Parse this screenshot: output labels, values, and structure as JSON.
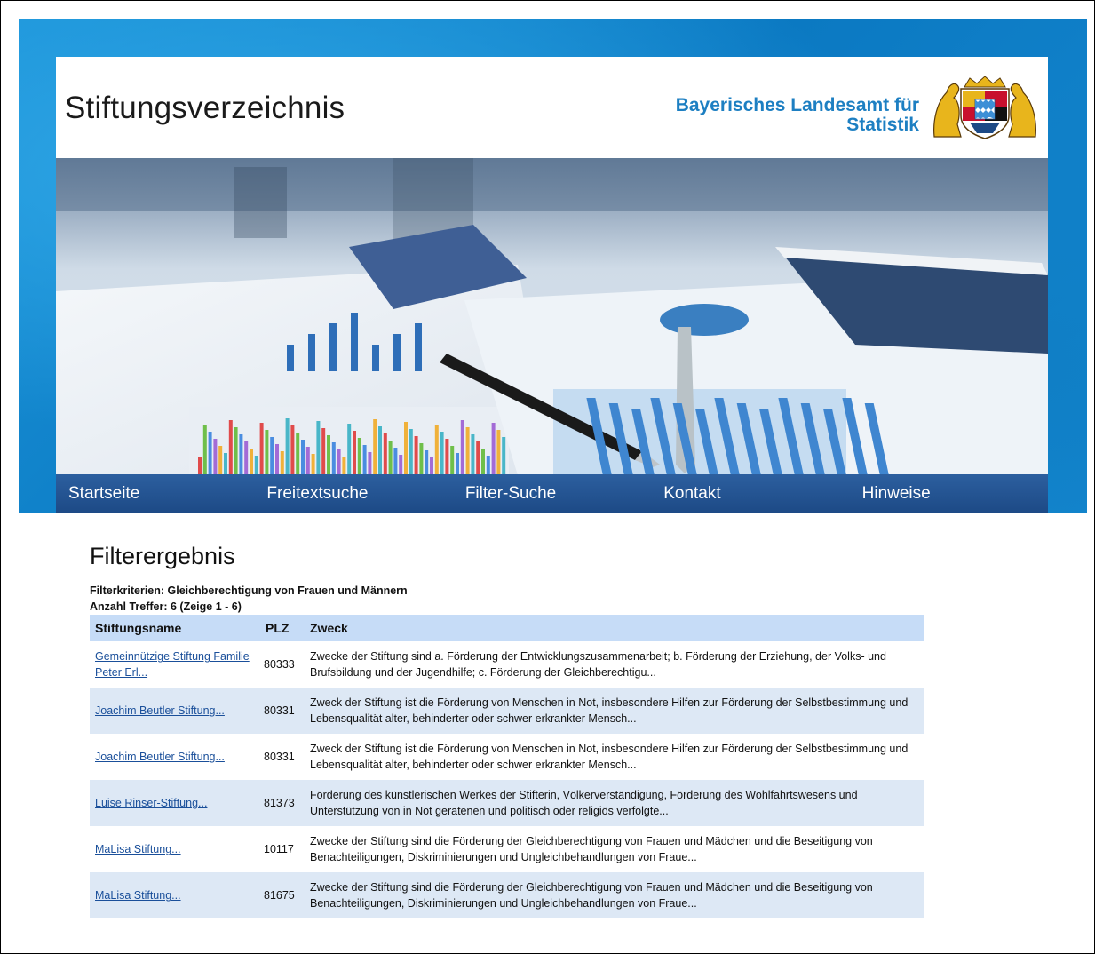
{
  "site": {
    "title": "Stiftungsverzeichnis",
    "agency_line1": "Bayerisches Landesamt für",
    "agency_line2": "Statistik",
    "coat_of_arms": "bavarian-coat-of-arms"
  },
  "nav": [
    {
      "label": "Startseite"
    },
    {
      "label": "Freitextsuche"
    },
    {
      "label": "Filter-Suche"
    },
    {
      "label": "Kontakt"
    },
    {
      "label": "Hinweise"
    }
  ],
  "result": {
    "heading": "Filterergebnis",
    "criteria": "Filterkriterien: Gleichberechtigung von Frauen und Männern",
    "count": "Anzahl Treffer: 6 (Zeige 1 - 6)",
    "columns": [
      "Stiftungsname",
      "PLZ",
      "Zweck"
    ],
    "rows": [
      {
        "name": "Gemeinnützige Stiftung Familie Peter Erl...",
        "plz": "80333",
        "zweck": "Zwecke der Stiftung sind a. Förderung der Entwicklungszusammenarbeit; b. Förderung der Erziehung, der Volks- und Brufsbildung und der Jugendhilfe; c. Förderung der Gleichberechtigu..."
      },
      {
        "name": "Joachim Beutler Stiftung...",
        "plz": "80331",
        "zweck": "Zweck der Stiftung ist die Förderung von Menschen in Not, insbesondere Hilfen zur Förderung der Selbstbestimmung und Lebensqualität alter, behinderter oder schwer erkrankter Mensch..."
      },
      {
        "name": "Joachim Beutler Stiftung...",
        "plz": "80331",
        "zweck": "Zweck der Stiftung ist die Förderung von Menschen in Not, insbesondere Hilfen zur Förderung der Selbstbestimmung und Lebensqualität alter, behinderter oder schwer erkrankter Mensch..."
      },
      {
        "name": "Luise Rinser-Stiftung...",
        "plz": "81373",
        "zweck": "Förderung des künstlerischen Werkes der Stifterin, Völkerverständigung, Förderung des Wohlfahrtswesens und Unterstützung von in Not geratenen und politisch oder religiös verfolgte..."
      },
      {
        "name": "MaLisa Stiftung...",
        "plz": "10117",
        "zweck": "Zwecke der Stiftung sind die Förderung der Gleichberechtigung von Frauen und Mädchen und die Beseitigung von Benachteiligungen, Diskriminierungen und Ungleichbehandlungen von Fraue..."
      },
      {
        "name": "MaLisa Stiftung...",
        "plz": "81675",
        "zweck": "Zwecke der Stiftung sind die Förderung der Gleichberechtigung von Frauen und Mädchen und die Beseitigung von Benachteiligungen, Diskriminierungen und Ungleichbehandlungen von Fraue..."
      }
    ]
  }
}
